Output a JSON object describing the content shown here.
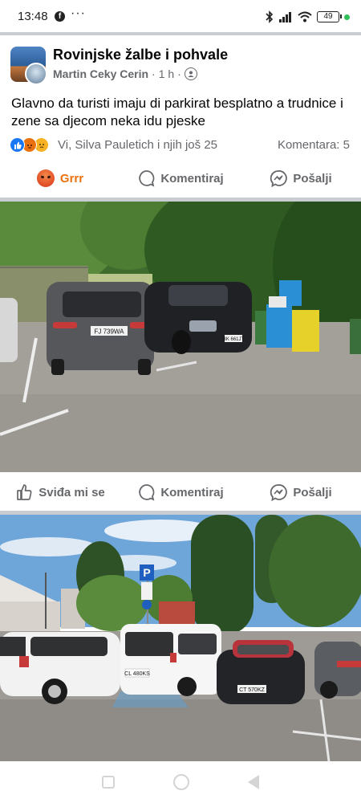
{
  "status_bar": {
    "time": "13:48",
    "app_icon": "facebook-icon",
    "more": "···",
    "battery": "49"
  },
  "post": {
    "group_name": "Rovinjske žalbe i pohvale",
    "author": "Martin Ceky Cerin",
    "time": "1 h",
    "dot": "·",
    "audience_icon": "members-icon",
    "text": "Glavno da turisti imaju di parkirat besplatno a trudnice i zene sa djecom neka idu pjeske",
    "reactions": {
      "icons": [
        "like-reaction-icon",
        "angry-reaction-icon",
        "sad-reaction-icon"
      ],
      "names": "Vi, Silva Pauletich i njih još 25",
      "comments": "Komentara: 5"
    },
    "actions": {
      "react": "Grrr",
      "comment": "Komentiraj",
      "send": "Pošalji"
    }
  },
  "photo1": {
    "plate_left": "FJ 739WA",
    "plate_right": "BK 661JT"
  },
  "photo1_actions": {
    "like": "Sviđa mi se",
    "comment": "Komentiraj",
    "send": "Pošalji"
  },
  "photo2": {
    "plate_van": "CL 480KS",
    "plate_cabrio": "CT 570KZ",
    "sign_p": "P"
  },
  "colors": {
    "accent_blue": "#1877f2",
    "angry_orange": "#e9710f",
    "muted": "#65676b"
  }
}
